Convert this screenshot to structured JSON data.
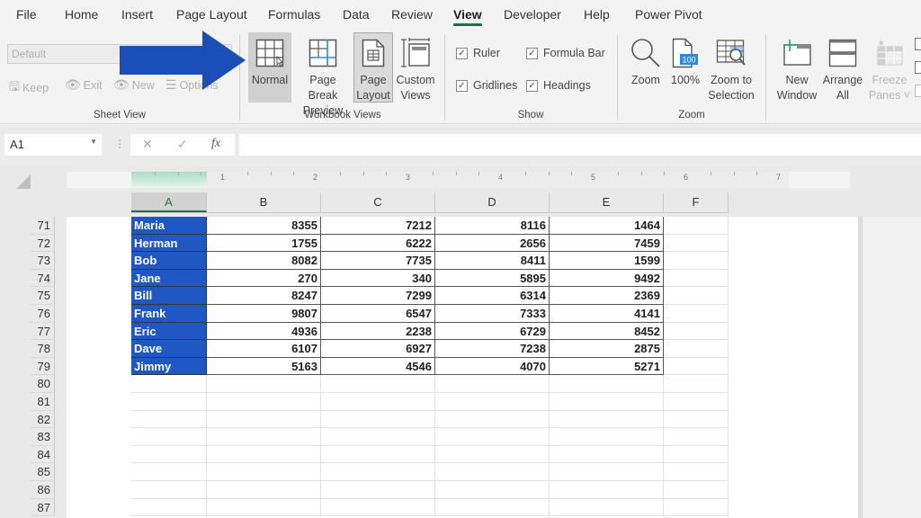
{
  "ribbon": {
    "tabs": [
      {
        "label": "File",
        "active": false
      },
      {
        "label": "Home",
        "active": false
      },
      {
        "label": "Insert",
        "active": false
      },
      {
        "label": "Page Layout",
        "active": false
      },
      {
        "label": "Formulas",
        "active": false
      },
      {
        "label": "Data",
        "active": false
      },
      {
        "label": "Review",
        "active": false
      },
      {
        "label": "View",
        "active": true
      },
      {
        "label": "Developer",
        "active": false
      },
      {
        "label": "Help",
        "active": false
      },
      {
        "label": "Power Pivot",
        "active": false
      }
    ],
    "sheet_view": {
      "group_label": "Sheet View",
      "dropdown_value": "Default",
      "buttons": [
        {
          "label": "Keep",
          "icon": "save-icon",
          "enabled": false
        },
        {
          "label": "Exit",
          "icon": "eye-exit-icon",
          "enabled": false
        },
        {
          "label": "New",
          "icon": "eye-new-icon",
          "enabled": false
        },
        {
          "label": "Options",
          "icon": "list-icon",
          "enabled": false
        }
      ]
    },
    "workbook_views": {
      "group_label": "Workbook Views",
      "buttons": [
        {
          "line1": "Normal",
          "line2": "",
          "icon": "grid-icon",
          "state": "hover"
        },
        {
          "line1": "Page Break",
          "line2": "Preview",
          "icon": "page-break-icon",
          "state": "normal"
        },
        {
          "line1": "Page",
          "line2": "Layout",
          "icon": "page-layout-icon",
          "state": "pressed"
        },
        {
          "line1": "Custom",
          "line2": "Views",
          "icon": "custom-views-icon",
          "state": "normal"
        }
      ]
    },
    "show": {
      "group_label": "Show",
      "checkboxes": [
        {
          "label": "Ruler",
          "checked": true
        },
        {
          "label": "Formula Bar",
          "checked": true
        },
        {
          "label": "Gridlines",
          "checked": true
        },
        {
          "label": "Headings",
          "checked": true
        }
      ]
    },
    "zoom": {
      "group_label": "Zoom",
      "buttons": [
        {
          "line1": "Zoom",
          "line2": "",
          "icon": "magnifier-icon"
        },
        {
          "line1": "100%",
          "line2": "",
          "icon": "zoom-100-icon",
          "badge": "100"
        },
        {
          "line1": "Zoom to",
          "line2": "Selection",
          "icon": "zoom-selection-icon"
        }
      ]
    },
    "window": {
      "buttons": [
        {
          "line1": "New",
          "line2": "Window",
          "icon": "new-window-icon",
          "enabled": true
        },
        {
          "line1": "Arrange",
          "line2": "All",
          "icon": "arrange-all-icon",
          "enabled": true
        },
        {
          "line1": "Freeze",
          "line2": "Panes ˅",
          "icon": "freeze-panes-icon",
          "enabled": false
        }
      ]
    }
  },
  "formula_bar": {
    "name_box": "A1",
    "cancel_icon": "✕",
    "enter_icon": "✓",
    "fx_label": "fx",
    "formula": ""
  },
  "ruler": {
    "numbers": [
      "1",
      "2",
      "3",
      "4",
      "5",
      "6",
      "7"
    ]
  },
  "sheet": {
    "columns": [
      "A",
      "B",
      "C",
      "D",
      "E",
      "F"
    ],
    "active_column": "A",
    "row_numbers": [
      "71",
      "72",
      "73",
      "74",
      "75",
      "76",
      "77",
      "78",
      "79",
      "80",
      "81",
      "82",
      "83",
      "84",
      "85",
      "86",
      "87"
    ],
    "rows": [
      {
        "name": "Maria",
        "b": "8355",
        "c": "7212",
        "d": "8116",
        "e": "1464"
      },
      {
        "name": "Herman",
        "b": "1755",
        "c": "6222",
        "d": "2656",
        "e": "7459"
      },
      {
        "name": "Bob",
        "b": "8082",
        "c": "7735",
        "d": "8411",
        "e": "1599"
      },
      {
        "name": "Jane",
        "b": "270",
        "c": "340",
        "d": "5895",
        "e": "9492"
      },
      {
        "name": "Bill",
        "b": "8247",
        "c": "7299",
        "d": "6314",
        "e": "2369"
      },
      {
        "name": "Frank",
        "b": "9807",
        "c": "6547",
        "d": "7333",
        "e": "4141"
      },
      {
        "name": "Eric",
        "b": "4936",
        "c": "2238",
        "d": "6729",
        "e": "8452"
      },
      {
        "name": "Dave",
        "b": "6107",
        "c": "6927",
        "d": "7238",
        "e": "2875"
      },
      {
        "name": "Jimmy",
        "b": "5163",
        "c": "4546",
        "d": "4070",
        "e": "5271"
      }
    ]
  },
  "annotation": {
    "type": "arrow",
    "color": "#1a4fb8",
    "points_to": "Normal"
  }
}
